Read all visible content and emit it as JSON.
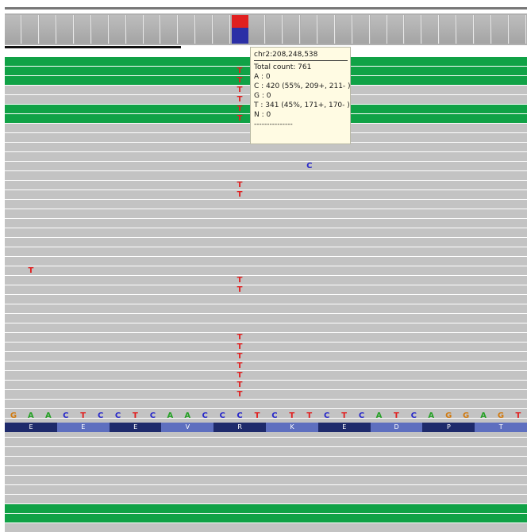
{
  "popup": {
    "locus": "chr2:208,248,538",
    "total": "Total count: 761",
    "base_a": "A : 0",
    "base_c": "C : 420 (55%, 209+, 211- )",
    "base_g": "G : 0",
    "base_t": "T : 341 (45%, 171+, 170- )",
    "base_n": "N : 0",
    "divider": "---------------"
  },
  "coverage": {
    "variant_fraction_c": 0.55,
    "variant_fraction_t": 0.45,
    "color_c": "#2b2fa6",
    "color_t": "#e02020"
  },
  "colors": {
    "A": "#27a027",
    "C": "#2929c9",
    "G": "#d07a10",
    "T": "#e02020",
    "read_gray": "#c3c3c3",
    "read_green": "#10a246",
    "aa_dark": "#1e2a6b",
    "aa_light": "#5e6fbf"
  },
  "reference_sequence": [
    "G",
    "A",
    "A",
    "C",
    "T",
    "C",
    "C",
    "T",
    "C",
    "A",
    "A",
    "C",
    "C",
    "C",
    "T",
    "C",
    "T",
    "T",
    "C",
    "T",
    "C",
    "A",
    "T",
    "C",
    "A",
    "G",
    "G",
    "A",
    "G",
    "T"
  ],
  "translation": [
    "E",
    "E",
    "E",
    "V",
    "R",
    "K",
    "E",
    "D",
    "P",
    "T"
  ],
  "reads": [
    "green",
    "green",
    "green",
    "gray",
    "gray",
    "green",
    "green",
    "gray",
    "gray",
    "gray",
    "gray",
    "gray",
    "gray",
    "gray",
    "gray",
    "gray",
    "gray",
    "gray",
    "gray",
    "gray",
    "gray",
    "gray",
    "gray",
    "gray",
    "gray",
    "gray",
    "gray",
    "gray",
    "gray",
    "gray",
    "gray",
    "gray",
    "gray",
    "gray",
    "gray",
    "gray",
    "gray",
    "gray",
    "gray",
    "gray",
    "gray",
    "gray",
    "gray",
    "gray",
    "gray",
    "gray",
    "gray",
    "green",
    "green",
    "gray"
  ],
  "mismatches": [
    {
      "row": 1,
      "col": 13,
      "base": "T"
    },
    {
      "row": 2,
      "col": 13,
      "base": "T"
    },
    {
      "row": 3,
      "col": 13,
      "base": "T"
    },
    {
      "row": 4,
      "col": 13,
      "base": "T"
    },
    {
      "row": 5,
      "col": 13,
      "base": "T"
    },
    {
      "row": 6,
      "col": 13,
      "base": "T"
    },
    {
      "row": 11,
      "col": 17,
      "base": "C"
    },
    {
      "row": 13,
      "col": 13,
      "base": "T"
    },
    {
      "row": 14,
      "col": 13,
      "base": "T"
    },
    {
      "row": 22,
      "col": 1,
      "base": "T"
    },
    {
      "row": 23,
      "col": 13,
      "base": "T"
    },
    {
      "row": 24,
      "col": 13,
      "base": "T"
    },
    {
      "row": 29,
      "col": 13,
      "base": "T"
    },
    {
      "row": 30,
      "col": 13,
      "base": "T"
    },
    {
      "row": 31,
      "col": 13,
      "base": "T"
    },
    {
      "row": 32,
      "col": 13,
      "base": "T"
    },
    {
      "row": 33,
      "col": 13,
      "base": "T"
    },
    {
      "row": 34,
      "col": 13,
      "base": "T"
    },
    {
      "row": 35,
      "col": 13,
      "base": "T"
    }
  ]
}
